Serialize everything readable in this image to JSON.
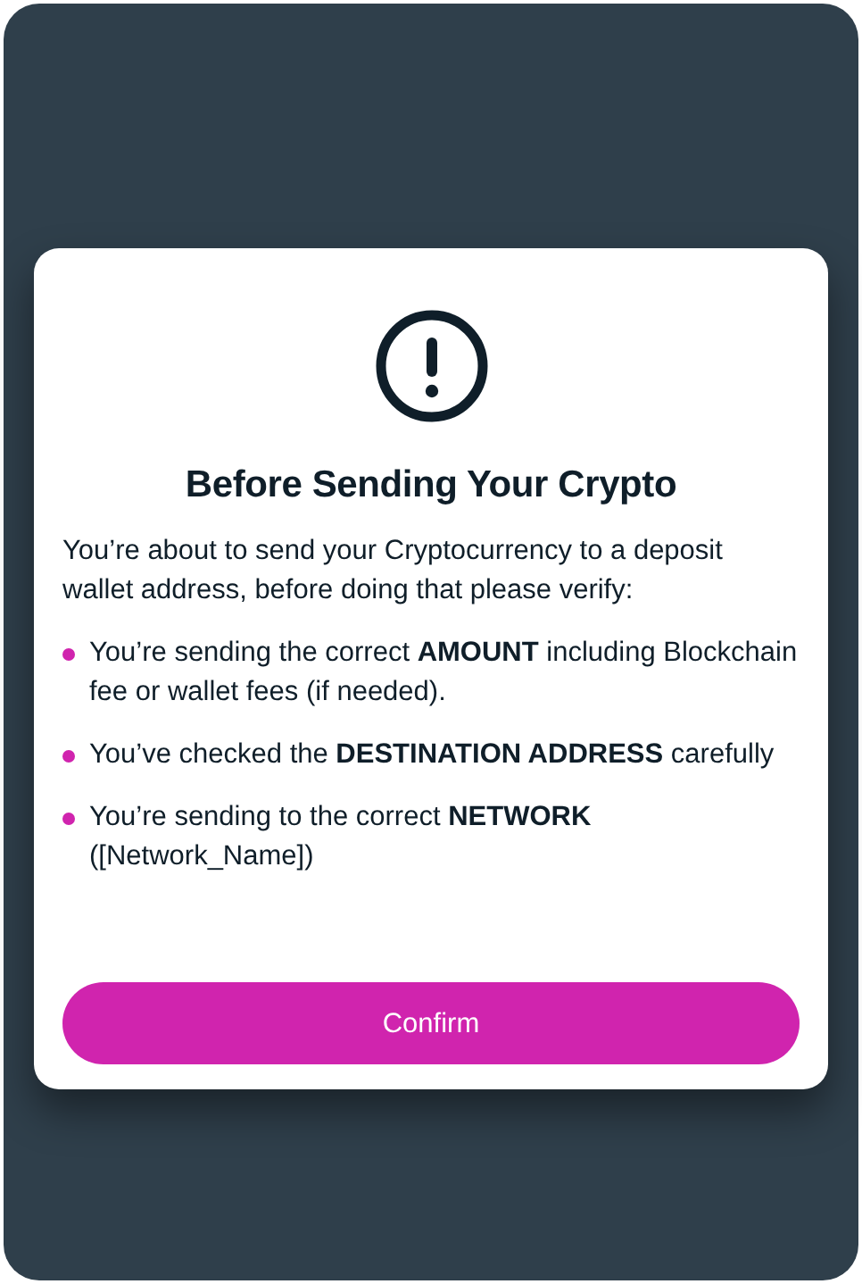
{
  "dialog": {
    "title": "Before Sending Your Crypto",
    "intro": "You’re about to send your Cryptocurrency to a deposit wallet address, before doing that please verify:",
    "checklist": [
      "You’re sending the correct **AMOUNT** including Blockchain fee or wallet fees (if needed).",
      "You’ve checked the **DESTINATION ADDRESS** carefully",
      "You’re sending to the correct **NETWORK** ([Network_Name])"
    ],
    "button": "Confirm"
  }
}
